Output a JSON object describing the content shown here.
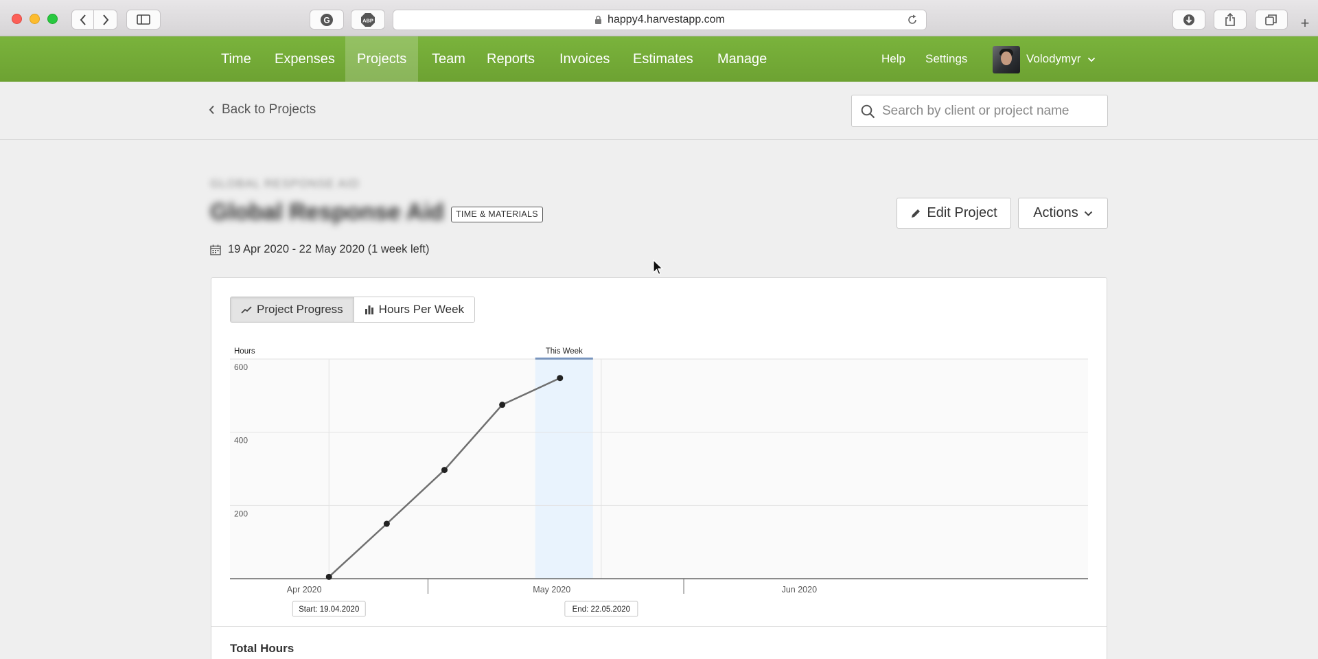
{
  "browser": {
    "url": "happy4.harvestapp.com",
    "button_labels": {
      "grammarly": "G",
      "adblock": "ABP",
      "new_tab": "+"
    }
  },
  "nav": {
    "items": [
      {
        "label": "Time",
        "active": false
      },
      {
        "label": "Expenses",
        "active": false
      },
      {
        "label": "Projects",
        "active": true
      },
      {
        "label": "Team",
        "active": false
      },
      {
        "label": "Reports",
        "active": false
      },
      {
        "label": "Invoices",
        "active": false
      },
      {
        "label": "Estimates",
        "active": false
      },
      {
        "label": "Manage",
        "active": false
      }
    ],
    "help": "Help",
    "settings": "Settings",
    "user": "Volodymyr"
  },
  "subheader": {
    "back_label": "Back to Projects",
    "search_placeholder": "Search by client or project name"
  },
  "project": {
    "client": "GLOBAL RESPONSE AID",
    "name": "Global Response Aid",
    "badge": "TIME & MATERIALS",
    "dates": "19 Apr 2020 - 22 May 2020 (1 week left)",
    "edit_label": "Edit Project",
    "actions_label": "Actions"
  },
  "tabs": {
    "progress": "Project Progress",
    "per_week": "Hours Per Week"
  },
  "colors": {
    "nav_green": "#74ab37",
    "line": "#6f6f6f",
    "this_week_fill": "#e9f3fd",
    "this_week_bar": "#3b68a8"
  },
  "chart_data": {
    "type": "line",
    "ylabel": "Hours",
    "yticks": [
      200,
      400,
      600
    ],
    "ylim": [
      0,
      600
    ],
    "x_labels": [
      "Apr 2020",
      "May 2020",
      "Jun 2020"
    ],
    "this_week_label": "This Week",
    "start_label": "Start: 19.04.2020",
    "end_label": "End: 22.05.2020",
    "series": [
      {
        "x": [
          "2020-04-19",
          "2020-04-26",
          "2020-05-03",
          "2020-05-10",
          "2020-05-17"
        ],
        "y": [
          5,
          150,
          297,
          475,
          548
        ]
      }
    ]
  },
  "summary": {
    "total_hours_label": "Total Hours"
  }
}
